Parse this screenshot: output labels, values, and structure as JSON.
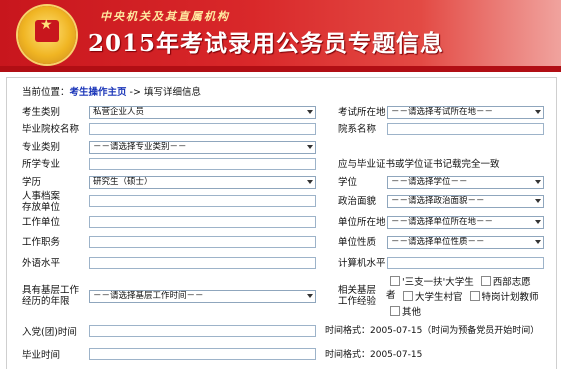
{
  "header": {
    "subtitle": "中央机关及其直属机构",
    "title": "2015年考试录用公务员专题信息"
  },
  "breadcrumb": {
    "prefix": "当前位置：",
    "home": "考生操作主页",
    "sep": " -> ",
    "current": "填写详细信息"
  },
  "form": {
    "candidate_type": {
      "label": "考生类别",
      "value": "私营企业人员"
    },
    "exam_location": {
      "label": "考试所在地",
      "value": "－－请选择考试所在地－－"
    },
    "school": {
      "label": "毕业院校名称"
    },
    "department": {
      "label": "院系名称"
    },
    "major_category": {
      "label": "专业类别",
      "value": "－－请选择专业类别－－"
    },
    "major": {
      "label": "所学专业"
    },
    "major_note": "应与毕业证书或学位证书记载完全一致",
    "education": {
      "label": "学历",
      "value": "研究生（硕士）"
    },
    "degree": {
      "label": "学位",
      "value": "－－请选择学位－－"
    },
    "archive_unit": {
      "label_line1": "人事档案",
      "label_line2": "存放单位"
    },
    "political_status": {
      "label": "政治面貌",
      "value": "－－请选择政治面貌－－"
    },
    "work_unit": {
      "label": "工作单位"
    },
    "unit_location": {
      "label": "单位所在地",
      "value": "－－请选择单位所在地－－"
    },
    "job_title": {
      "label": "工作职务"
    },
    "unit_nature": {
      "label": "单位性质",
      "value": "－－请选择单位性质－－"
    },
    "foreign_language": {
      "label": "外语水平"
    },
    "computer_level": {
      "label": "计算机水平"
    },
    "grassroots_years": {
      "label_line1": "具有基层工作",
      "label_line2": "经历的年限",
      "value": "－－请选择基层工作时间－－"
    },
    "grassroots_exp": {
      "label_line1": "相关基层",
      "label_line2": "工作经验",
      "opt1": "'三支一扶'大学生",
      "opt2": "西部志愿",
      "opt2_cont": "者",
      "opt3": "大学生村官",
      "opt4": "特岗计划教师",
      "opt5": "其他"
    },
    "party_date": {
      "label": "入党(团)时间",
      "note": "时间格式：2005-07-15（时间为预备党员开始时间）"
    },
    "grad_date": {
      "label": "毕业时间",
      "note": "时间格式：2005-07-15"
    }
  },
  "colors": {
    "banner": "#d9282a",
    "link": "#1a35b8"
  }
}
